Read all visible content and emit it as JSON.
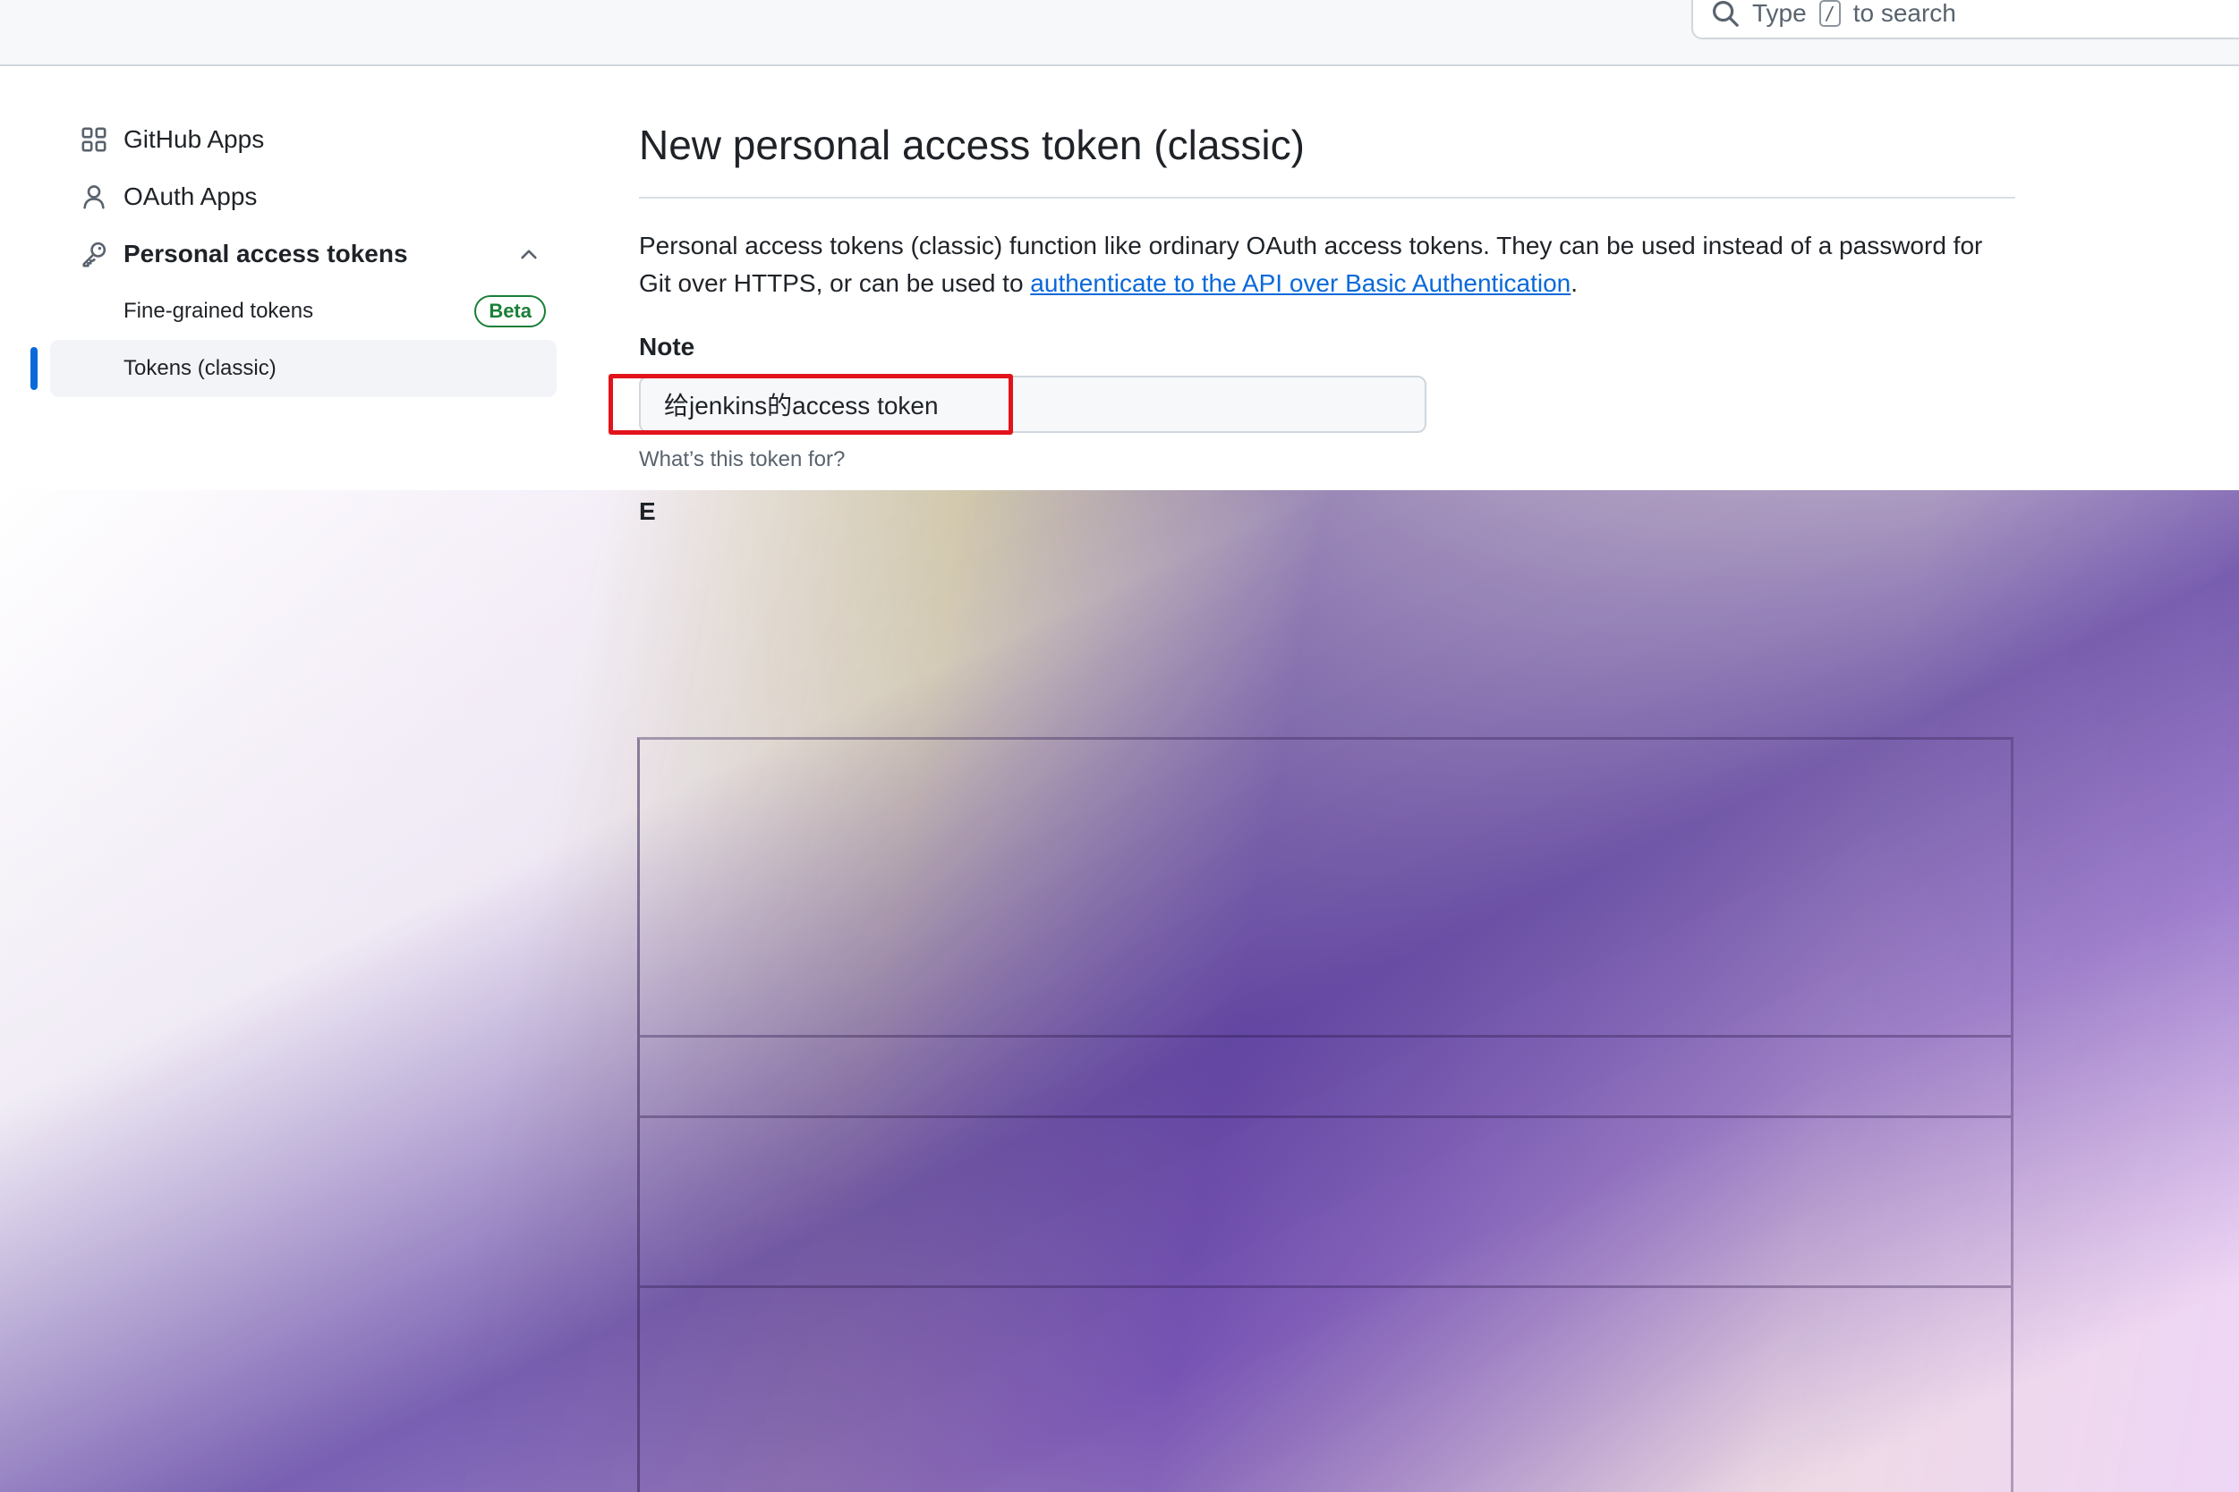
{
  "topbar": {
    "search": {
      "prefix": "Type",
      "key": "/",
      "suffix": "to search",
      "icon": "search-icon"
    }
  },
  "sidebar": {
    "items": [
      {
        "label": "GitHub Apps",
        "icon": "apps-grid-icon"
      },
      {
        "label": "OAuth Apps",
        "icon": "person-icon"
      },
      {
        "label": "Personal access tokens",
        "icon": "key-icon",
        "expanded": true
      }
    ],
    "subitems": [
      {
        "label": "Fine-grained tokens",
        "badge": "Beta"
      },
      {
        "label": "Tokens (classic)",
        "active": true
      }
    ]
  },
  "main": {
    "title": "New personal access token (classic)",
    "description_prefix": "Personal access tokens (classic) function like ordinary OAuth access tokens. They can be used instead of a password for Git over HTTPS, or can be used to ",
    "description_link": "authenticate to the API over Basic Authentication",
    "description_suffix": ".",
    "note": {
      "label": "Note",
      "value": "给jenkins的access token",
      "hint": "What’s this token for?"
    },
    "expiration_label_partial": "E"
  },
  "colors": {
    "accent": "#0969da",
    "beta": "#1a7f37",
    "highlight": "#e3131b"
  }
}
